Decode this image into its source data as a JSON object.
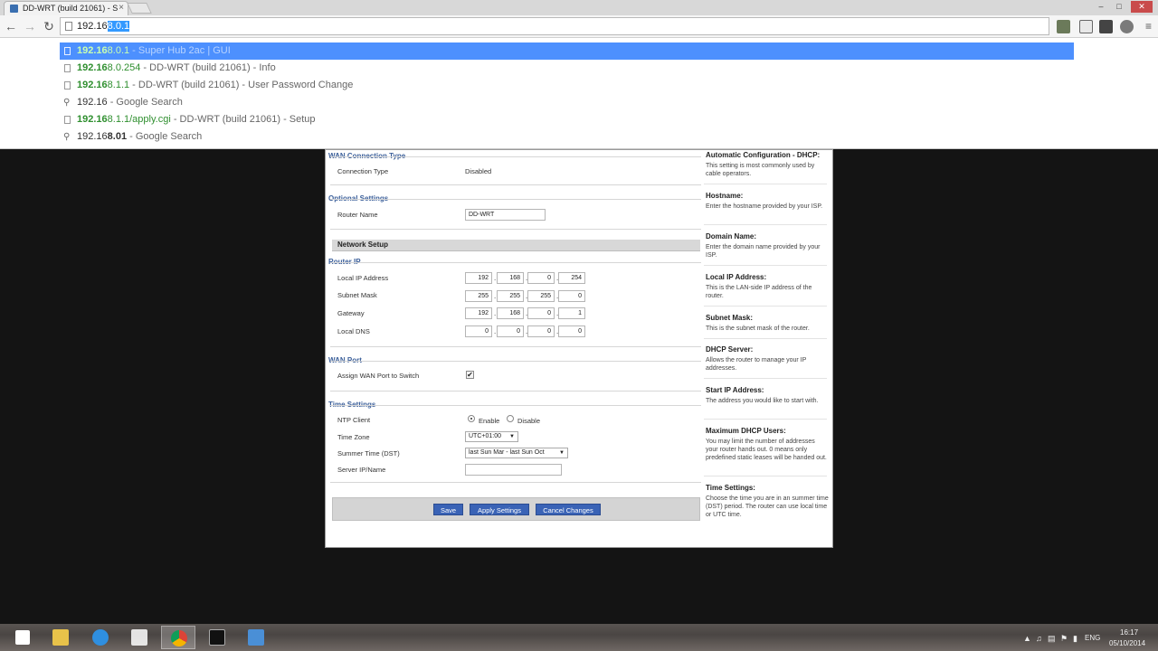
{
  "browser": {
    "tab_title": "DD-WRT (build 21061) - S",
    "tab_close": "×",
    "window_controls": [
      "–",
      "□",
      "✕"
    ],
    "address": {
      "typed": "192.16",
      "selected": "8.0.1"
    }
  },
  "icons": {
    "back": "back-arrow-icon",
    "forward": "forward-arrow-icon",
    "reload": "reload-icon",
    "page": "page-icon",
    "search": "magnifier-icon",
    "menu": "hamburger-menu-icon"
  },
  "suggestions": [
    {
      "url_bold": "192.16",
      "url_rest": "8.0.1",
      "desc": " - Super Hub 2ac | GUI",
      "type": "page",
      "selected": true
    },
    {
      "url_bold": "192.16",
      "url_rest": "8.0.254",
      "desc": " - DD-WRT (build 21061) - Info",
      "type": "page"
    },
    {
      "url_bold": "192.16",
      "url_rest": "8.1.1",
      "desc": " - DD-WRT (build 21061) - User Password Change",
      "type": "page"
    },
    {
      "plain": "192.16",
      "desc": " - Google Search",
      "type": "search"
    },
    {
      "url_bold": "192.16",
      "url_rest": "8.1.1/apply.cgi",
      "desc": " - DD-WRT (build 21061) - Setup",
      "type": "page"
    },
    {
      "plain": "192.16",
      "plain_bold": "8.01",
      "desc": " - Google Search",
      "type": "search"
    }
  ],
  "router": {
    "wan_connection": {
      "legend": "WAN Connection Type",
      "label": "Connection Type",
      "value": "Disabled"
    },
    "optional": {
      "legend": "Optional Settings",
      "router_name_label": "Router Name",
      "router_name_value": "DD-WRT"
    },
    "network_setup_title": "Network Setup",
    "router_ip": {
      "legend": "Router IP",
      "rows": [
        {
          "label": "Local IP Address",
          "octets": [
            "192",
            "168",
            "0",
            "254"
          ]
        },
        {
          "label": "Subnet Mask",
          "octets": [
            "255",
            "255",
            "255",
            "0"
          ]
        },
        {
          "label": "Gateway",
          "octets": [
            "192",
            "168",
            "0",
            "1"
          ]
        },
        {
          "label": "Local DNS",
          "octets": [
            "0",
            "0",
            "0",
            "0"
          ]
        }
      ]
    },
    "wan_port": {
      "legend": "WAN Port",
      "label": "Assign WAN Port to Switch",
      "checked": true,
      "check_mark": "✔"
    },
    "time": {
      "legend": "Time Settings",
      "ntp_label": "NTP Client",
      "enable": "Enable",
      "disable": "Disable",
      "ntp_enabled": true,
      "tz_label": "Time Zone",
      "tz_value": "UTC+01:00",
      "dst_label": "Summer Time (DST)",
      "dst_value": "last Sun Mar - last Sun Oct",
      "server_label": "Server IP/Name",
      "server_value": ""
    },
    "buttons": {
      "save": "Save",
      "apply": "Apply Settings",
      "cancel": "Cancel Changes"
    },
    "help": [
      {
        "title": "Automatic Configuration - DHCP:",
        "text": "This setting is most commonly used by cable operators."
      },
      {
        "title": "Hostname:",
        "text": "Enter the hostname provided by your ISP."
      },
      {
        "title": "Domain Name:",
        "text": "Enter the domain name provided by your ISP."
      },
      {
        "title": "Local IP Address:",
        "text": "This is the LAN-side IP address of the router."
      },
      {
        "title": "Subnet Mask:",
        "text": "This is the subnet mask of the router."
      },
      {
        "title": "DHCP Server:",
        "text": "Allows the router to manage your IP addresses."
      },
      {
        "title": "Start IP Address:",
        "text": "The address you would like to start with."
      },
      {
        "title": "Maximum DHCP Users:",
        "text": "You may limit the number of addresses your router hands out. 0 means only predefined static leases will be handed out."
      },
      {
        "title": "Time Settings:",
        "text": "Choose the time you are in an summer time (DST) period. The router can use local time or UTC time."
      }
    ]
  },
  "taskbar": {
    "apps": [
      "start-icon",
      "file-explorer-icon",
      "internet-explorer-icon",
      "store-icon",
      "chrome-icon",
      "command-prompt-icon",
      "remote-desktop-icon"
    ],
    "lang": "ENG",
    "time": "16:17",
    "date": "05/10/2014"
  }
}
